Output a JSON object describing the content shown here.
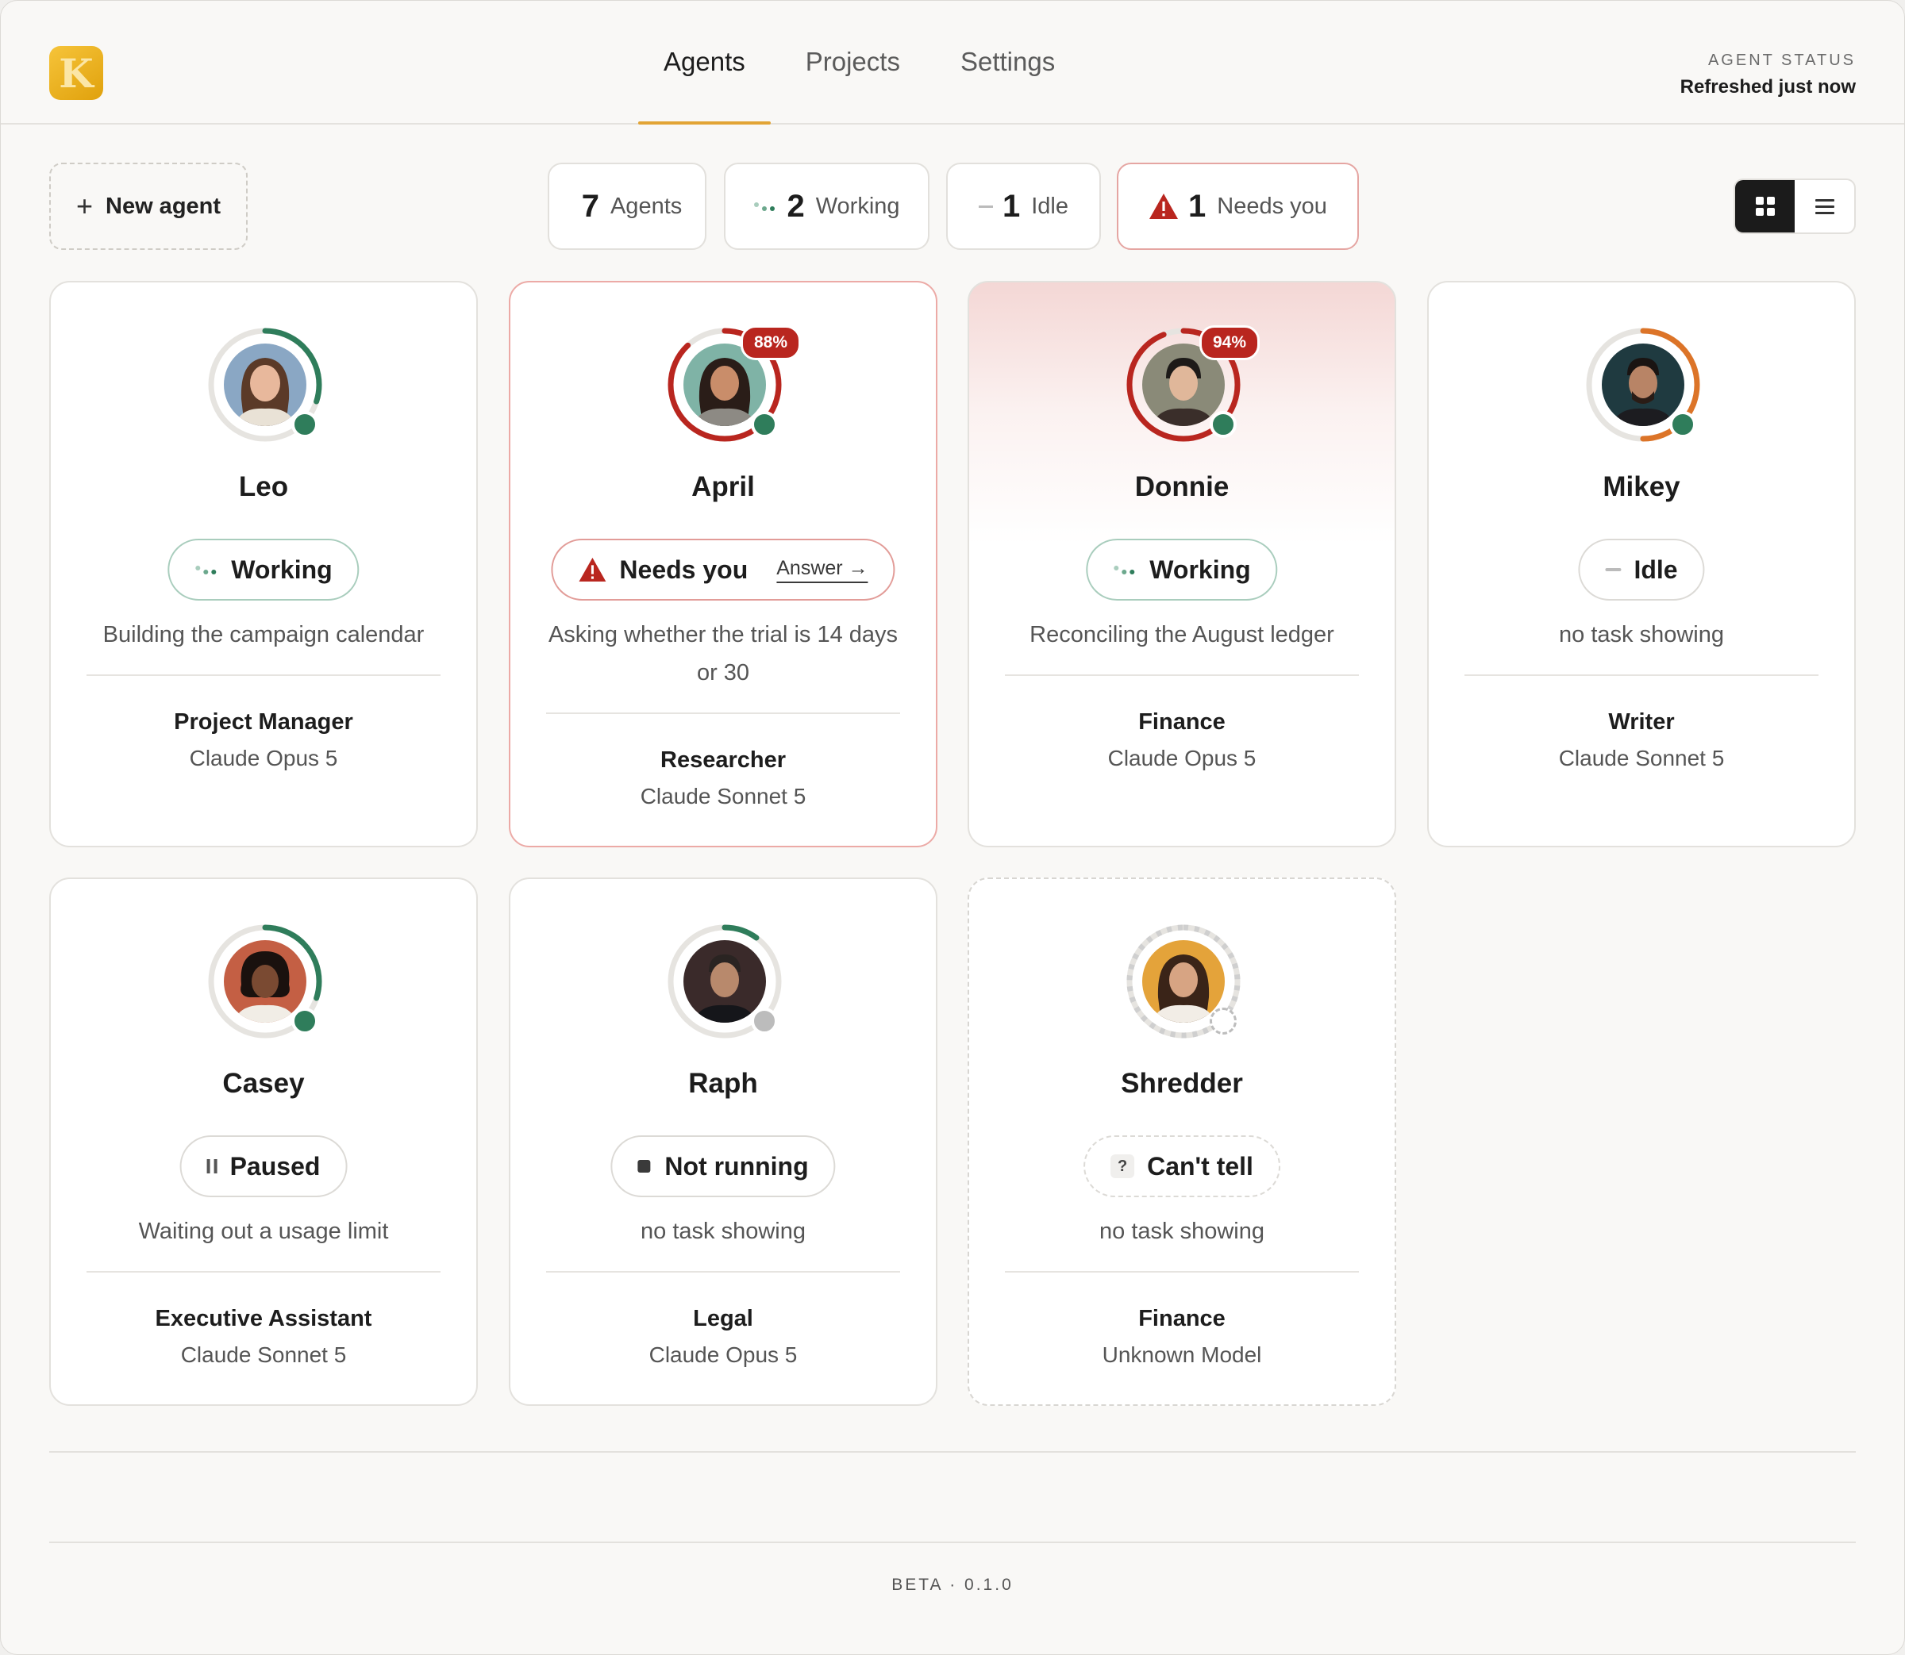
{
  "header": {
    "tabs": [
      "Agents",
      "Projects",
      "Settings"
    ],
    "active_tab": "Agents",
    "status_label": "AGENT STATUS",
    "status_value": "Refreshed just now",
    "logo_letter": "K"
  },
  "toolbar": {
    "new_agent": "New agent",
    "counts": [
      {
        "num": "7",
        "label": "Agents"
      },
      {
        "num": "2",
        "label": "Working"
      },
      {
        "num": "1",
        "label": "Idle"
      },
      {
        "num": "1",
        "label": "Needs you"
      }
    ],
    "view_modes": [
      "grid-view",
      "list-view"
    ],
    "active_view": "grid-view"
  },
  "agents": [
    {
      "name": "Leo",
      "status": "Working",
      "task": "Building the campaign calendar",
      "role": "Project Manager",
      "model": "Claude Opus 5",
      "ring_color": "#2f7d5b",
      "ring_fraction": 0.3,
      "online": "green"
    },
    {
      "name": "April",
      "status": "Needs you",
      "action": "Answer",
      "task": "Asking whether the trial is 14 days or 30",
      "role": "Researcher",
      "model": "Claude Sonnet 5",
      "ring_color": "#b9261f",
      "ring_fraction": 0.88,
      "context": "88%",
      "online": "green"
    },
    {
      "name": "Donnie",
      "status": "Working",
      "task": "Reconciling the August ledger",
      "role": "Finance",
      "model": "Claude Opus 5",
      "ring_color": "#b9261f",
      "ring_fraction": 0.94,
      "context": "94%",
      "online": "green"
    },
    {
      "name": "Mikey",
      "status": "Idle",
      "task": "no task showing",
      "role": "Writer",
      "model": "Claude Sonnet 5",
      "ring_color": "#dc7428",
      "ring_fraction": 0.5,
      "online": "green"
    },
    {
      "name": "Casey",
      "status": "Paused",
      "task": "Waiting out a usage limit",
      "role": "Executive Assistant",
      "model": "Claude Sonnet 5",
      "ring_color": "#2f7d5b",
      "ring_fraction": 0.3,
      "online": "green"
    },
    {
      "name": "Raph",
      "status": "Not running",
      "task": "no task showing",
      "role": "Legal",
      "model": "Claude Opus 5",
      "ring_color": "#2f7d5b",
      "ring_fraction": 0.1,
      "online": "gray"
    },
    {
      "name": "Shredder",
      "status": "Can't tell",
      "task": "no task showing",
      "role": "Finance",
      "model": "Unknown Model",
      "ring_color": "#cfcfcf",
      "ring_fraction": 1.0,
      "online": "unknown"
    }
  ],
  "footer": {
    "version": "BETA · 0.1.0"
  },
  "colors": {
    "working": "#2f7d5b",
    "alert": "#b9261f",
    "idle": "#dc7428",
    "accent": "#e2a435"
  }
}
